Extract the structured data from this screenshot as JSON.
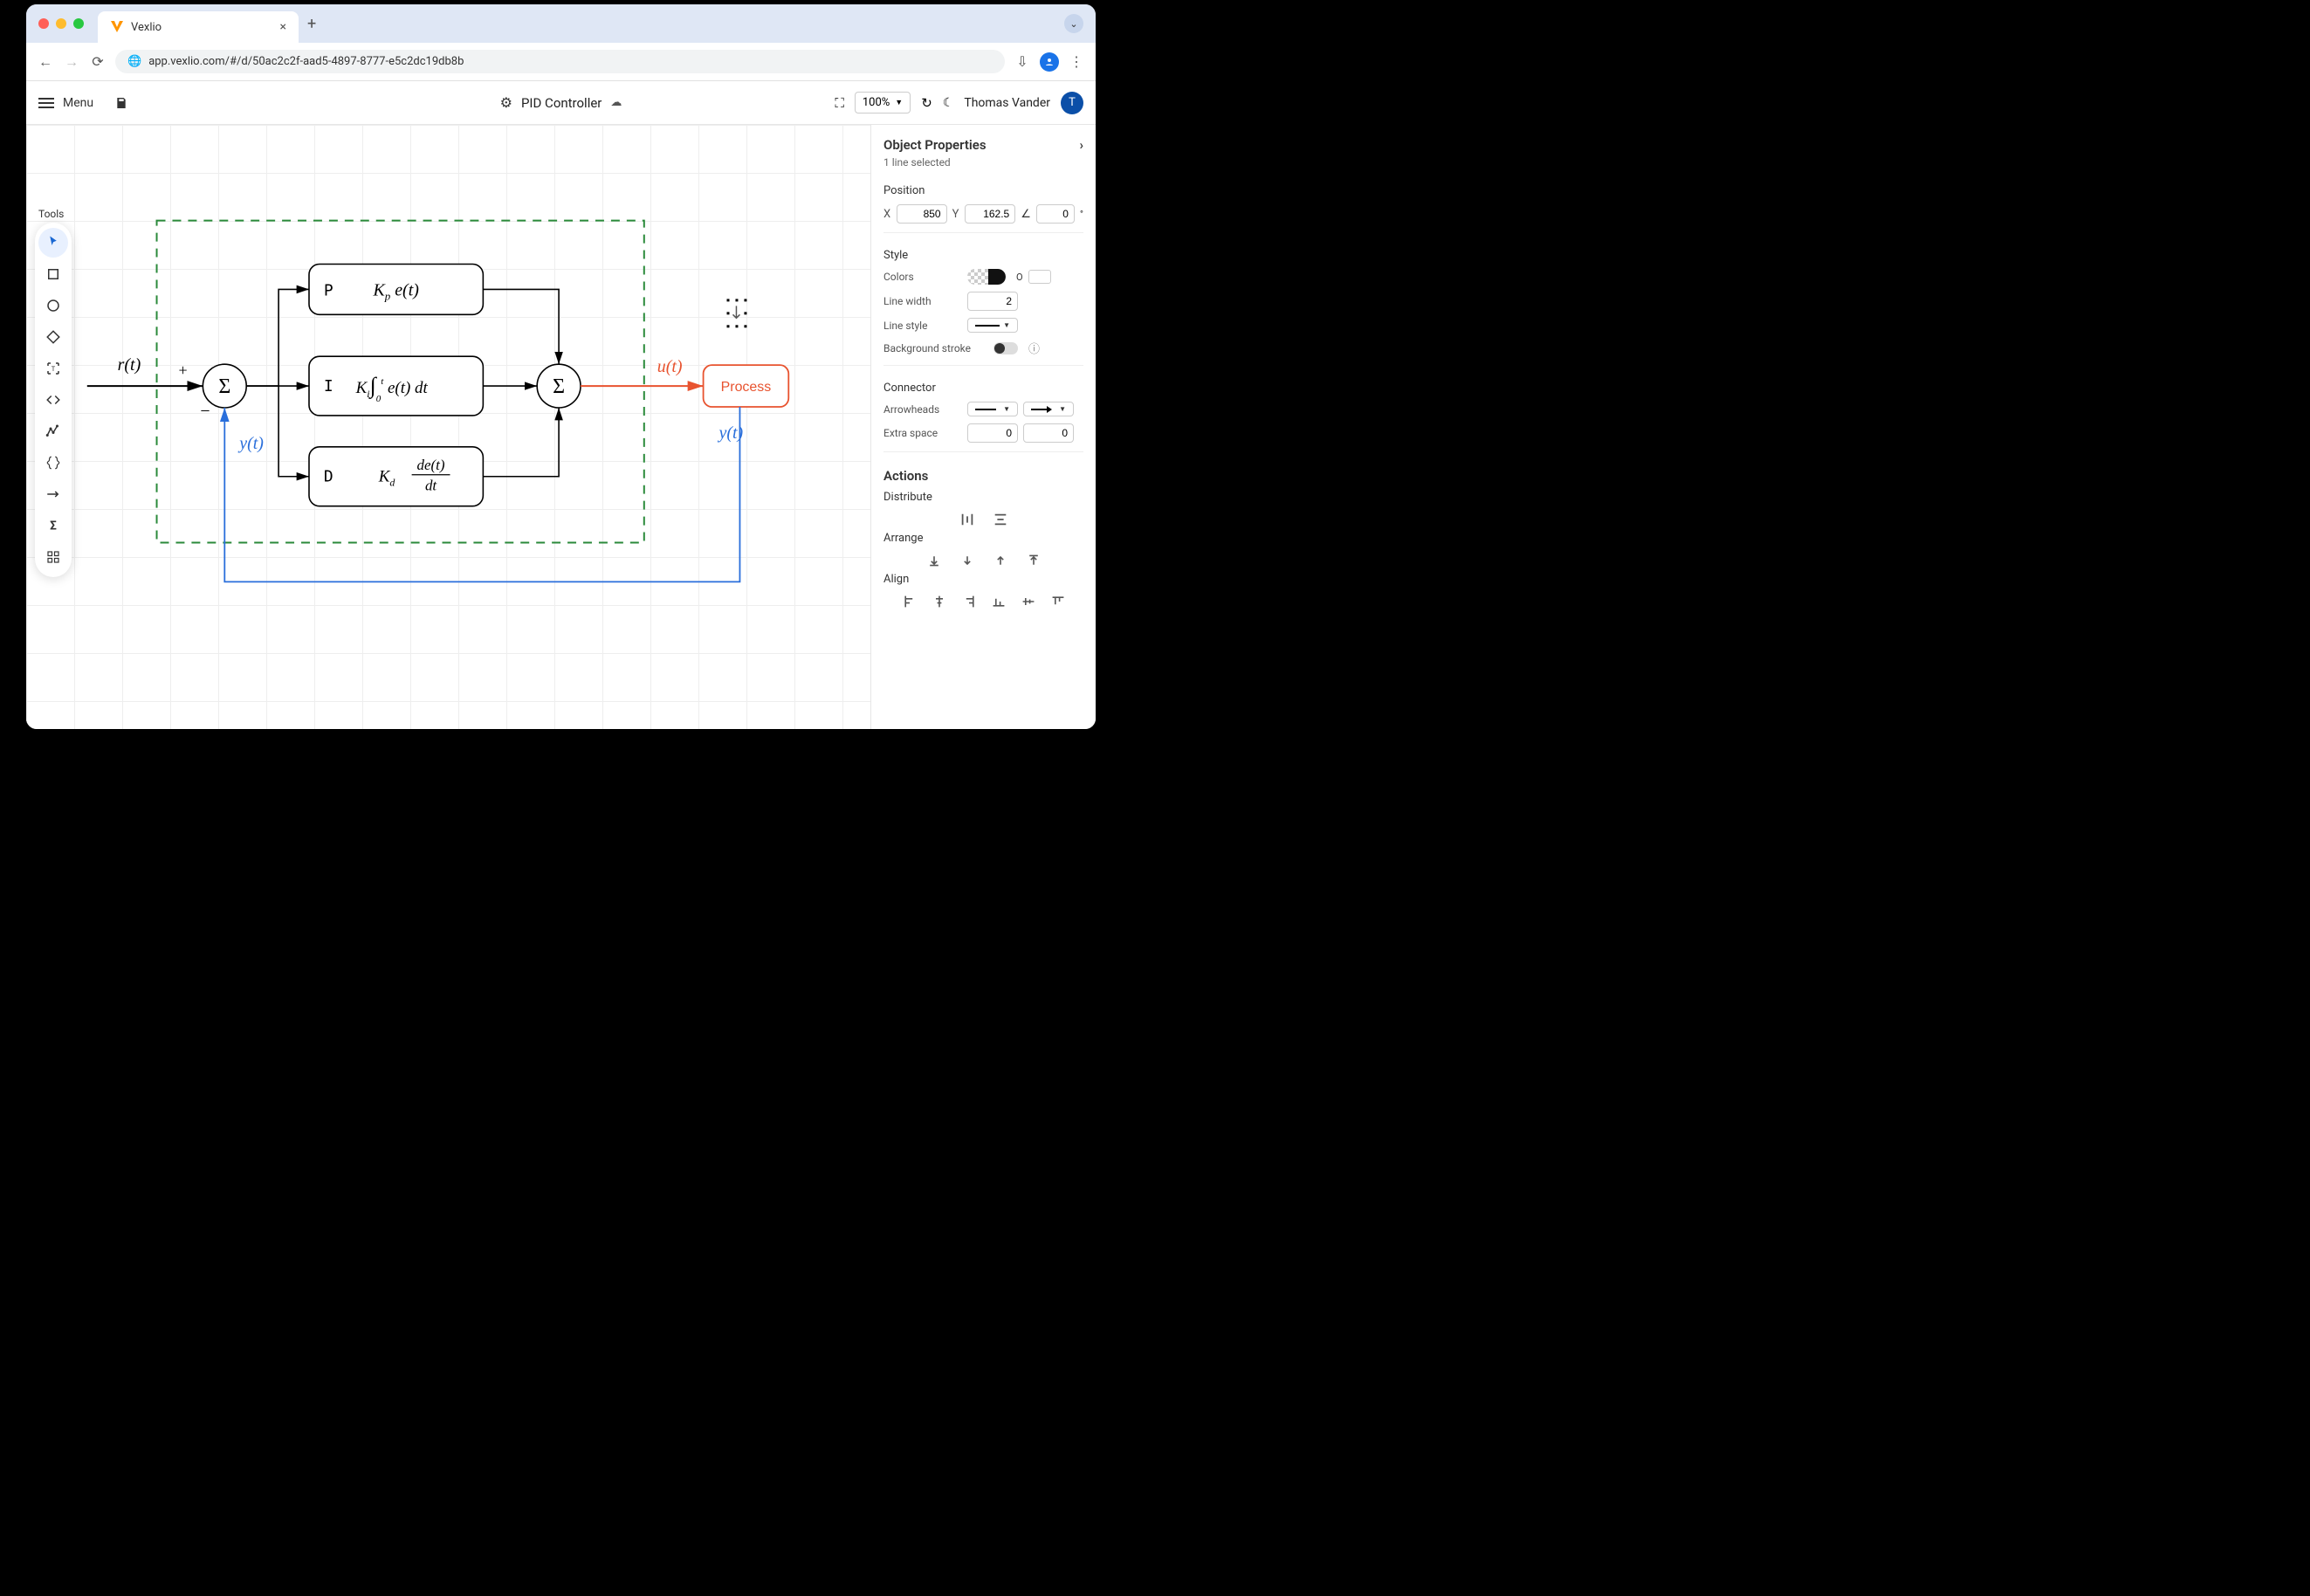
{
  "browser": {
    "tab_title": "Vexlio",
    "url": "app.vexlio.com/#/d/50ac2c2f-aad5-4897-8777-e5c2dc19db8b"
  },
  "topbar": {
    "menu_label": "Menu",
    "doc_title": "PID Controller",
    "zoom": "100%",
    "user_name": "Thomas Vander",
    "user_initial": "T"
  },
  "tools": {
    "panel_title": "Tools"
  },
  "diagram": {
    "dashed_box": true,
    "input_label": "r(t)",
    "plus": "+",
    "minus": "−",
    "feedback_label_left": "y(t)",
    "p_letter": "P",
    "i_letter": "I",
    "d_letter": "D",
    "p_expr": "K_p e(t)",
    "i_expr": "K_i ∫_0^t e(t) dt",
    "d_expr": "K_d de(t)/dt",
    "u_label": "u(t)",
    "process_label": "Process",
    "feedback_label_right": "y(t)"
  },
  "sidepanel": {
    "title": "Object Properties",
    "subtitle": "1 line selected",
    "position_label": "Position",
    "x_label": "X",
    "x_value": "850",
    "y_label": "Y",
    "y_value": "162.5",
    "angle_value": "0",
    "angle_unit": "°",
    "style_label": "Style",
    "colors_label": "Colors",
    "opacity_label": "O",
    "line_width_label": "Line width",
    "line_width_value": "2",
    "line_style_label": "Line style",
    "bg_stroke_label": "Background stroke",
    "connector_label": "Connector",
    "arrowheads_label": "Arrowheads",
    "extra_space_label": "Extra space",
    "extra_space_a": "0",
    "extra_space_b": "0",
    "actions_label": "Actions",
    "distribute_label": "Distribute",
    "arrange_label": "Arrange",
    "align_label": "Align"
  }
}
